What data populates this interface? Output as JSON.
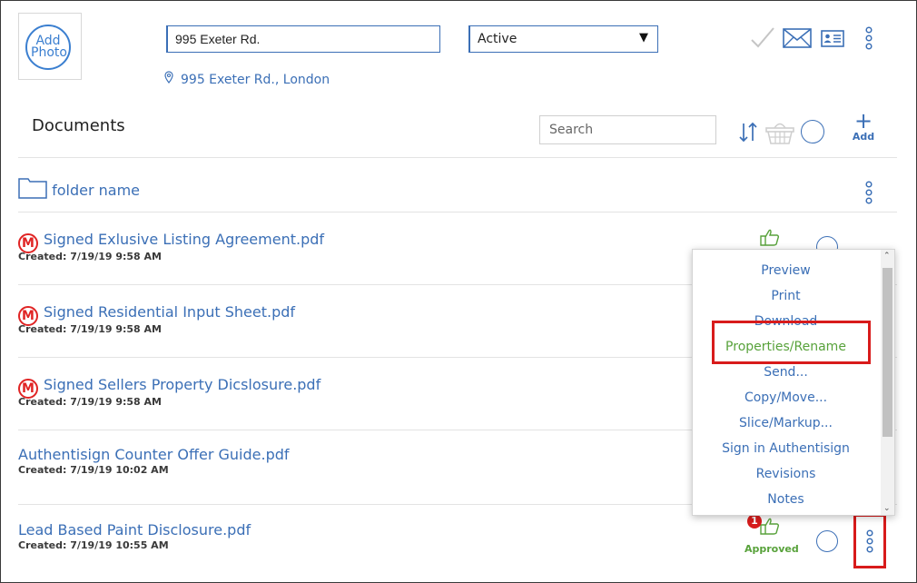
{
  "header": {
    "photo_label": "Add Photo",
    "address_value": "995 Exeter Rd.",
    "status_value": "Active",
    "location_text": "995 Exeter Rd., London"
  },
  "documents": {
    "title": "Documents",
    "search_placeholder": "Search",
    "add_label": "Add",
    "folder_name": "folder name",
    "files": [
      {
        "name": "Signed Exlusive Listing Agreement.pdf",
        "created": "Created: 7/19/19 9:58 AM",
        "badge": "M"
      },
      {
        "name": "Signed Residential Input Sheet.pdf",
        "created": "Created: 7/19/19 9:58 AM",
        "badge": "M"
      },
      {
        "name": "Signed Sellers Property Dicslosure.pdf",
        "created": "Created: 7/19/19 9:58 AM",
        "badge": "M"
      },
      {
        "name": "Authentisign Counter Offer Guide.pdf",
        "created": "Created: 7/19/19 10:02 AM",
        "badge": ""
      },
      {
        "name": "Lead Based Paint Disclosure.pdf",
        "created": "Created: 7/19/19 10:55 AM",
        "badge": "",
        "status": "Approved",
        "notification_count": "1"
      }
    ]
  },
  "context_menu": {
    "items": [
      "Preview",
      "Print",
      "Download",
      "Properties/Rename",
      "Send...",
      "Copy/Move...",
      "Slice/Markup...",
      "Sign in Authentisign",
      "Revisions",
      "Notes"
    ],
    "highlighted": "Properties/Rename"
  },
  "colors": {
    "accent": "#3b6fb6",
    "highlight": "#d81b1b",
    "approved": "#58a23b",
    "marked": "#e02424"
  }
}
